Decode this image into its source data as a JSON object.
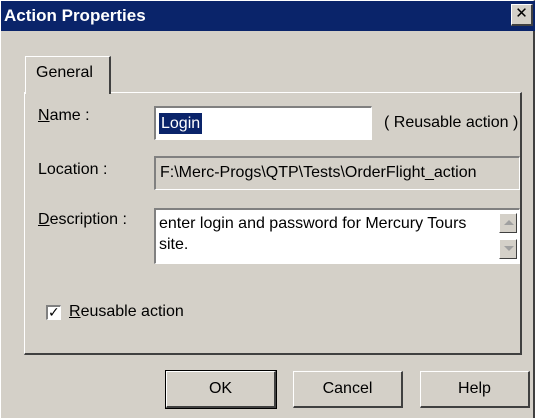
{
  "window": {
    "title": "Action Properties",
    "close_glyph": "✕"
  },
  "tabs": [
    {
      "label": "General",
      "active": true
    }
  ],
  "form": {
    "name": {
      "label_prefix": "",
      "label_access": "N",
      "label_rest": "ame :",
      "value": "Login",
      "note": "( Reusable action )"
    },
    "location": {
      "label": "Location :",
      "value": "F:\\Merc-Progs\\QTP\\Tests\\OrderFlight_action"
    },
    "description": {
      "label_access": "D",
      "label_rest": "escription :",
      "value": "enter login and password for Mercury Tours site."
    },
    "reusable": {
      "checked": true,
      "check_glyph": "✓",
      "label_access": "R",
      "label_rest": "eusable action"
    }
  },
  "buttons": {
    "ok": "OK",
    "cancel": "Cancel",
    "help": "Help"
  },
  "colors": {
    "titlebar": "#0a246a",
    "face": "#d4d0c8",
    "selection": "#0a246a"
  },
  "icons": {
    "close": "close-icon",
    "scroll_up": "scroll-up-arrow-icon",
    "scroll_down": "scroll-down-arrow-icon",
    "check": "check-icon"
  }
}
